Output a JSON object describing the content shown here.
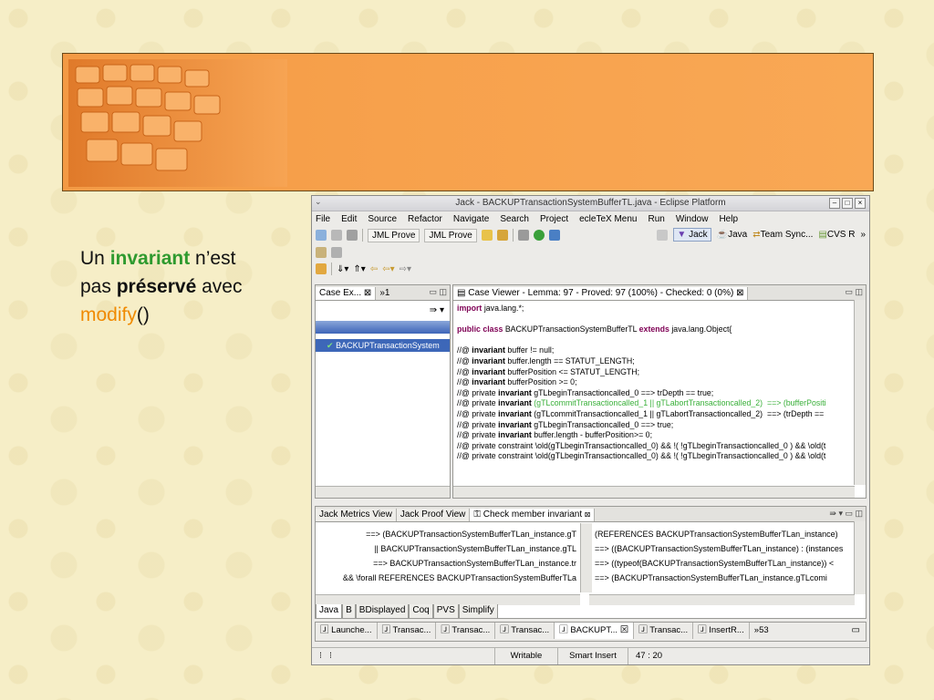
{
  "slide": {
    "line1_plain": "Un ",
    "line1_emph": "invariant",
    "line1_end": " n’est",
    "line2_plain": "pas ",
    "line2_bold": "préservé",
    "line2_end": " avec",
    "line3_method": "modify",
    "line3_parens": "()"
  },
  "window": {
    "title": "Jack - BACKUPTransactionSystemBufferTL.java - Eclipse Platform",
    "menu": [
      "File",
      "Edit",
      "Source",
      "Refactor",
      "Navigate",
      "Search",
      "Project",
      "ecleTeX Menu",
      "Run",
      "Window",
      "Help"
    ],
    "toolbar": {
      "jml_prove_1": "JML Prove",
      "jml_prove_2": "JML Prove"
    },
    "perspectives": {
      "jack": "Jack",
      "java": "Java",
      "team": "Team Sync...",
      "cvs": "CVS R",
      "more": "»"
    }
  },
  "case_explorer": {
    "tab": "Case Ex...",
    "more": "»1",
    "item": "BACKUPTransactionSystem"
  },
  "case_viewer": {
    "tab": "Case Viewer - Lemma: 97 - Proved: 97 (100%) - Checked: 0 (0%)",
    "lines": [
      "import java.lang.*;",
      "",
      "public class BACKUPTransactionSystemBufferTL extends java.lang.Object{",
      "",
      "//@ invariant buffer != null;",
      "//@ invariant buffer.length == STATUT_LENGTH;",
      "//@ invariant bufferPosition <= STATUT_LENGTH;",
      "//@ invariant bufferPosition >= 0;",
      "//@ private invariant gTLbeginTransactioncalled_0 ==> trDepth == true;",
      "//@ private invariant (gTLcommitTransactioncalled_1 || gTLabortTransactioncalled_2)  ==> (bufferPositi",
      "//@ private invariant (gTLcommitTransactioncalled_1 || gTLabortTransactioncalled_2)  ==> (trDepth ==",
      "//@ private invariant gTLbeginTransactioncalled_0 ==> true;",
      "//@ private invariant buffer.length - bufferPosition>= 0;",
      "//@ private constraint \\old(gTLbeginTransactioncalled_0) && !( !gTLbeginTransactioncalled_0 ) && \\old(t",
      "//@ private constraint \\old(gTLbeginTransactioncalled_0) && !( !gTLbeginTransactioncalled_0 ) && \\old(t"
    ]
  },
  "bottom": {
    "tabs": [
      "Jack Metrics View",
      "Jack Proof View",
      "Check member invariant"
    ],
    "left_lines": [
      "==> (BACKUPTransactionSystemBufferTLan_instance.gT",
      "|| BACKUPTransactionSystemBufferTLan_instance.gTL",
      "==> BACKUPTransactionSystemBufferTLan_instance.tr",
      "&& \\forall REFERENCES BACKUPTransactionSystemBufferTLa"
    ],
    "right_lines": [
      "(REFERENCES BACKUPTransactionSystemBufferTLan_instance)",
      "==> ((BACKUPTransactionSystemBufferTLan_instance) : (instances",
      "==> ((typeof(BACKUPTransactionSystemBufferTLan_instance)) <",
      "==> (BACKUPTransactionSystemBufferTLan_instance.gTLcomi"
    ],
    "subtabs": [
      "Java",
      "B",
      "BDisplayed",
      "Coq",
      "PVS",
      "Simplify"
    ]
  },
  "files": [
    "Launche...",
    "Transac...",
    "Transac...",
    "Transac...",
    "BACKUPT...",
    "Transac...",
    "InsertR..."
  ],
  "files_more": "»53",
  "status": {
    "writable": "Writable",
    "insert": "Smart Insert",
    "pos": "47 : 20"
  }
}
